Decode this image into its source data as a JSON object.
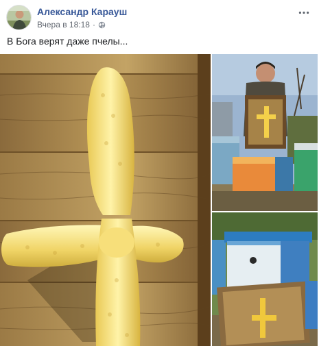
{
  "post": {
    "author": "Александр Карауш",
    "timestamp": "Вчера в 18:18",
    "separator": "·",
    "privacy_icon": "globe-icon",
    "more_icon": "more-horizontal-icon",
    "text": "В Бога верят даже пчелы..."
  },
  "colors": {
    "author_link": "#385898",
    "meta": "#616770",
    "text": "#1c1e21"
  }
}
